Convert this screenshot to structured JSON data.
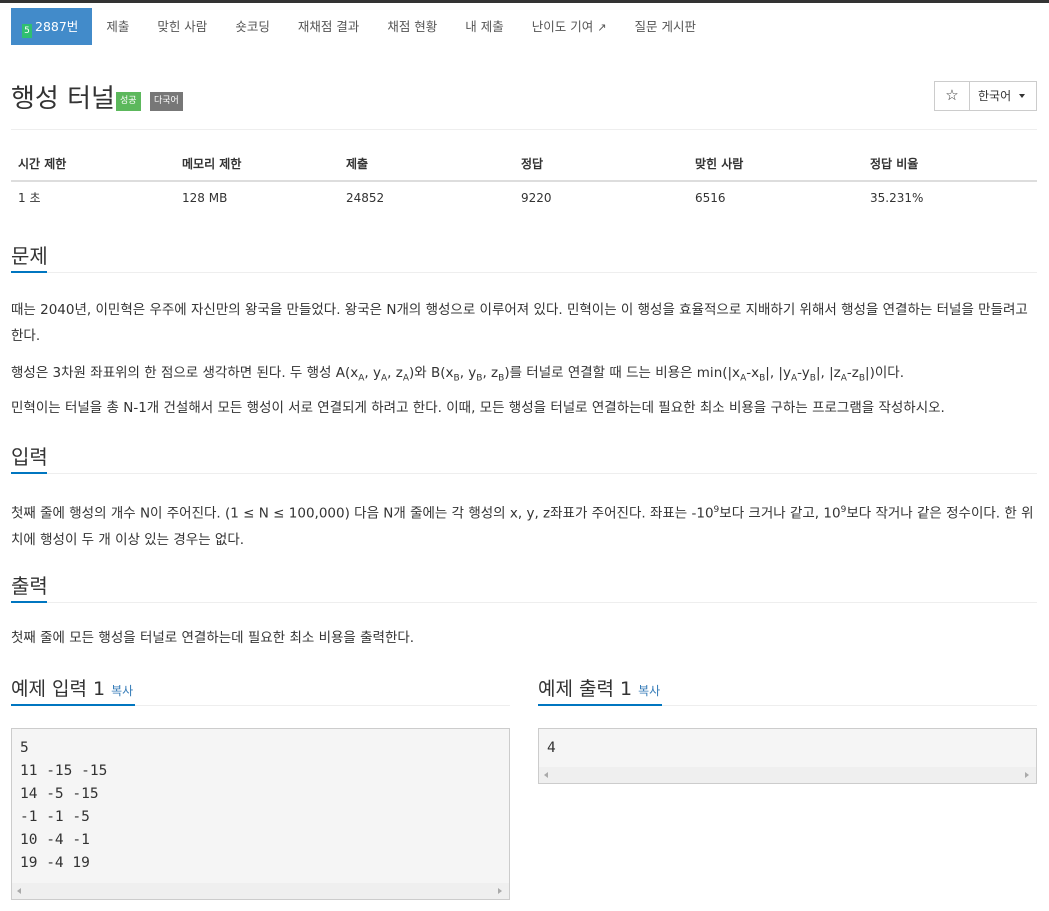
{
  "nav": {
    "problem_level": "5",
    "problem_label": "2887번",
    "items": [
      "제출",
      "맞힌 사람",
      "숏코딩",
      "재채점 결과",
      "채점 현황",
      "내 제출",
      "난이도 기여",
      "질문 게시판"
    ],
    "external_icon": "external-link-icon"
  },
  "header": {
    "title": "행성 터널",
    "badge_success": "성공",
    "badge_multilang": "다국어",
    "star": "☆",
    "language": "한국어"
  },
  "info": {
    "headers": [
      "시간 제한",
      "메모리 제한",
      "제출",
      "정답",
      "맞힌 사람",
      "정답 비율"
    ],
    "values": [
      "1 초",
      "128 MB",
      "24852",
      "9220",
      "6516",
      "35.231%"
    ]
  },
  "sections": {
    "problem_title": "문제",
    "problem_p1": "때는 2040년, 이민혁은 우주에 자신만의 왕국을 만들었다. 왕국은 N개의 행성으로 이루어져 있다. 민혁이는 이 행성을 효율적으로 지배하기 위해서 행성을 연결하는 터널을 만들려고 한다.",
    "problem_p3": "민혁이는 터널을 총 N-1개 건설해서 모든 행성이 서로 연결되게 하려고 한다. 이때, 모든 행성을 터널로 연결하는데 필요한 최소 비용을 구하는 프로그램을 작성하시오.",
    "input_title": "입력",
    "output_title": "출력",
    "output_p": "첫째 줄에 모든 행성을 터널로 연결하는데 필요한 최소 비용을 출력한다."
  },
  "formula": {
    "intro": "행성은 3차원 좌표위의 한 점으로 생각하면 된다. 두 행성 A(x",
    "A": "A",
    "B": "B",
    "cost_mid": ")를 터널로 연결할 때 드는 비용은 min(|x",
    "end": "|)이다."
  },
  "input_text": {
    "a": "첫째 줄에 행성의 개수 N이 주어진다. (1 ≤ N ≤ 100,000) 다음 N개 줄에는 각 행성의 x, y, z좌표가 주어진다. 좌표는 -10",
    "exp": "9",
    "b": "보다 크거나 같고, 10",
    "c": "보다 작거나 같은 정수이다. 한 위치에 행성이 두 개 이상 있는 경우는 없다."
  },
  "examples": {
    "input_title": "예제 입력 1",
    "output_title": "예제 출력 1",
    "copy": "복사",
    "input_body": "5\n11 -15 -15\n14 -5 -15\n-1 -1 -5\n10 -4 -1\n19 -4 19",
    "output_body": "4"
  }
}
